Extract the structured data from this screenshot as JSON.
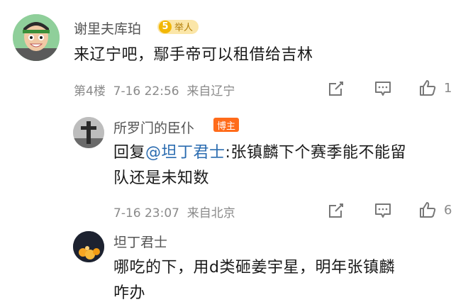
{
  "comment1": {
    "username": "谢里夫库珀",
    "badge": {
      "level": "5",
      "label": "举人"
    },
    "text": "来辽宁吧，鄢手帝可以租借给吉林",
    "meta": "第4楼  7-16 22:56  来自辽宁",
    "likes": "1"
  },
  "comment2": {
    "username": "所罗门的臣仆",
    "badge": "博主",
    "reply_prefix": "回复",
    "mention": "@坦丁君士",
    "text_after_mention": ":张镇麟下个赛季能不能留",
    "text_line2": "队还是未知数",
    "meta": "7-16 23:07  来自北京",
    "likes": "6"
  },
  "comment3": {
    "username": "坦丁君士",
    "text_line1": "哪吃的下，用d类砸姜宇星，明年张镇麟",
    "text_line2": "咋办"
  },
  "icons": [
    "share-icon",
    "comment-icon",
    "like-icon"
  ],
  "colors": {
    "mention": "#2b6cb0",
    "host_badge": "#ff6b1a",
    "fan_badge": "#fbe6a8"
  }
}
